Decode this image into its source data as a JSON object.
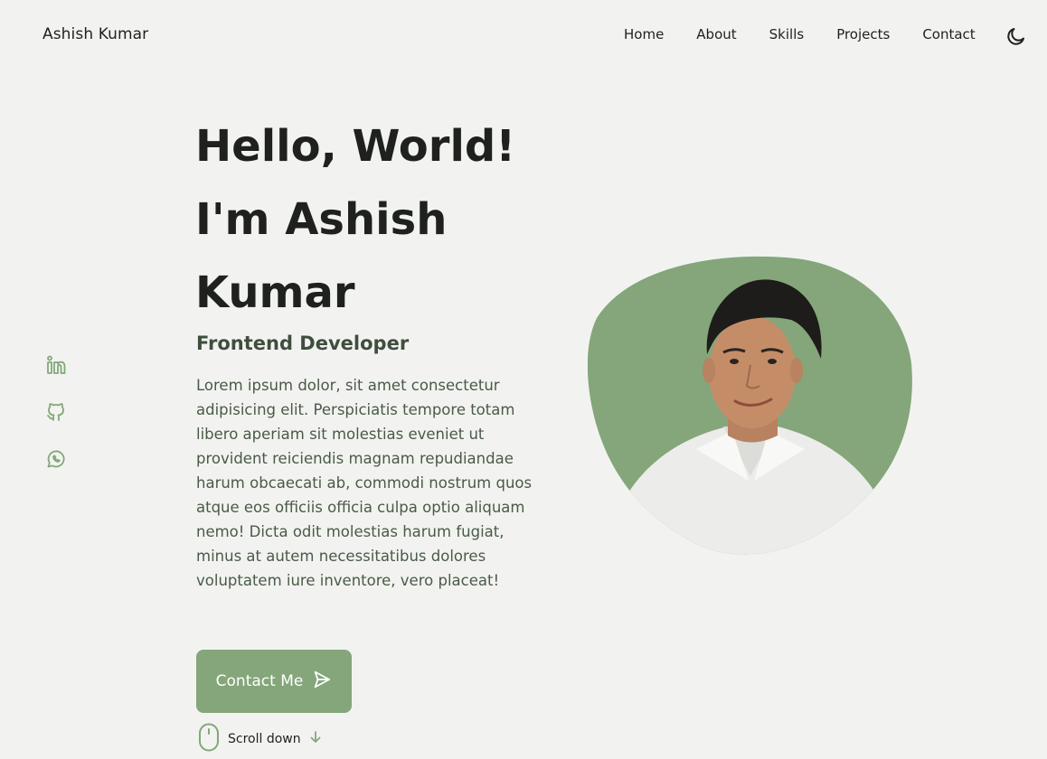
{
  "navbar": {
    "logo": "Ashish Kumar",
    "links": [
      "Home",
      "About",
      "Skills",
      "Projects",
      "Contact"
    ],
    "theme_icon": "moon-icon"
  },
  "socials": [
    {
      "name": "linkedin-icon"
    },
    {
      "name": "github-icon"
    },
    {
      "name": "whatsapp-icon"
    }
  ],
  "hero": {
    "title_line1": "Hello, World!",
    "title_line2": "I'm Ashish",
    "title_line3": "Kumar",
    "subtitle": "Frontend Developer",
    "description": "Lorem ipsum dolor, sit amet consectetur adipisicing elit. Perspiciatis tempore totam libero aperiam sit molestias eveniet ut provident reiciendis magnam repudiandae harum obcaecati ab, commodi nostrum quos atque eos officiis officia culpa optio aliquam nemo! Dicta odit molestias harum fugiat, minus at autem necessitatibus dolores voluptatem iure inventore, vero placeat!",
    "button_label": "Contact Me",
    "button_icon": "send-icon",
    "scroll_label": "Scroll down",
    "scroll_icon": "mouse-icon",
    "arrow_icon": "arrow-down-icon"
  },
  "colors": {
    "accent": "#84a67a",
    "background": "#f2f3f1",
    "text": "#1e211d"
  }
}
